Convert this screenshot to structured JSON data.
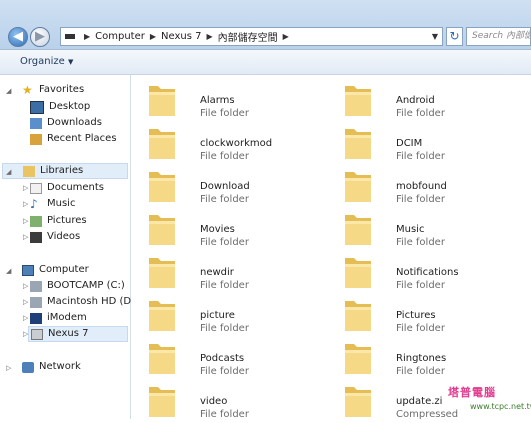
{
  "address": {
    "crumbs": [
      "Computer",
      "Nexus 7",
      "內部儲存空間"
    ],
    "search_placeholder": "Search 內部儲存..."
  },
  "toolbar": {
    "organize_label": "Organize"
  },
  "sidebar": {
    "favorites": {
      "label": "Favorites",
      "items": [
        {
          "label": "Desktop",
          "icon": "desktop-icon"
        },
        {
          "label": "Downloads",
          "icon": "downloads-icon"
        },
        {
          "label": "Recent Places",
          "icon": "recent-places-icon"
        }
      ]
    },
    "libraries": {
      "label": "Libraries",
      "items": [
        {
          "label": "Documents",
          "icon": "documents-icon"
        },
        {
          "label": "Music",
          "icon": "music-icon"
        },
        {
          "label": "Pictures",
          "icon": "pictures-icon"
        },
        {
          "label": "Videos",
          "icon": "videos-icon"
        }
      ]
    },
    "computer": {
      "label": "Computer",
      "items": [
        {
          "label": "BOOTCAMP (C:)",
          "icon": "drive-icon"
        },
        {
          "label": "Macintosh HD (D:)",
          "icon": "drive-icon"
        },
        {
          "label": "iModem",
          "icon": "modem-icon"
        },
        {
          "label": "Nexus 7",
          "icon": "device-icon"
        }
      ]
    },
    "network": {
      "label": "Network"
    }
  },
  "folders": [
    {
      "name": "Alarms",
      "type": "File folder"
    },
    {
      "name": "Android",
      "type": "File folder"
    },
    {
      "name": "clockworkmod",
      "type": "File folder"
    },
    {
      "name": "DCIM",
      "type": "File folder"
    },
    {
      "name": "Download",
      "type": "File folder"
    },
    {
      "name": "mobfound",
      "type": "File folder"
    },
    {
      "name": "Movies",
      "type": "File folder"
    },
    {
      "name": "Music",
      "type": "File folder"
    },
    {
      "name": "newdir",
      "type": "File folder"
    },
    {
      "name": "Notifications",
      "type": "File folder"
    },
    {
      "name": "picture",
      "type": "File folder"
    },
    {
      "name": "Pictures",
      "type": "File folder"
    },
    {
      "name": "Podcasts",
      "type": "File folder"
    },
    {
      "name": "Ringtones",
      "type": "File folder"
    },
    {
      "name": "video",
      "type": "File folder"
    },
    {
      "name": "update.zi",
      "type": "Compressed"
    }
  ],
  "watermark": {
    "line1": "塔普電腦",
    "line2": "www.tcpc.net.tw"
  },
  "colors": {
    "folder": "#f3d37b",
    "accent": "#2f6db5",
    "selection": "#e1edf8"
  }
}
